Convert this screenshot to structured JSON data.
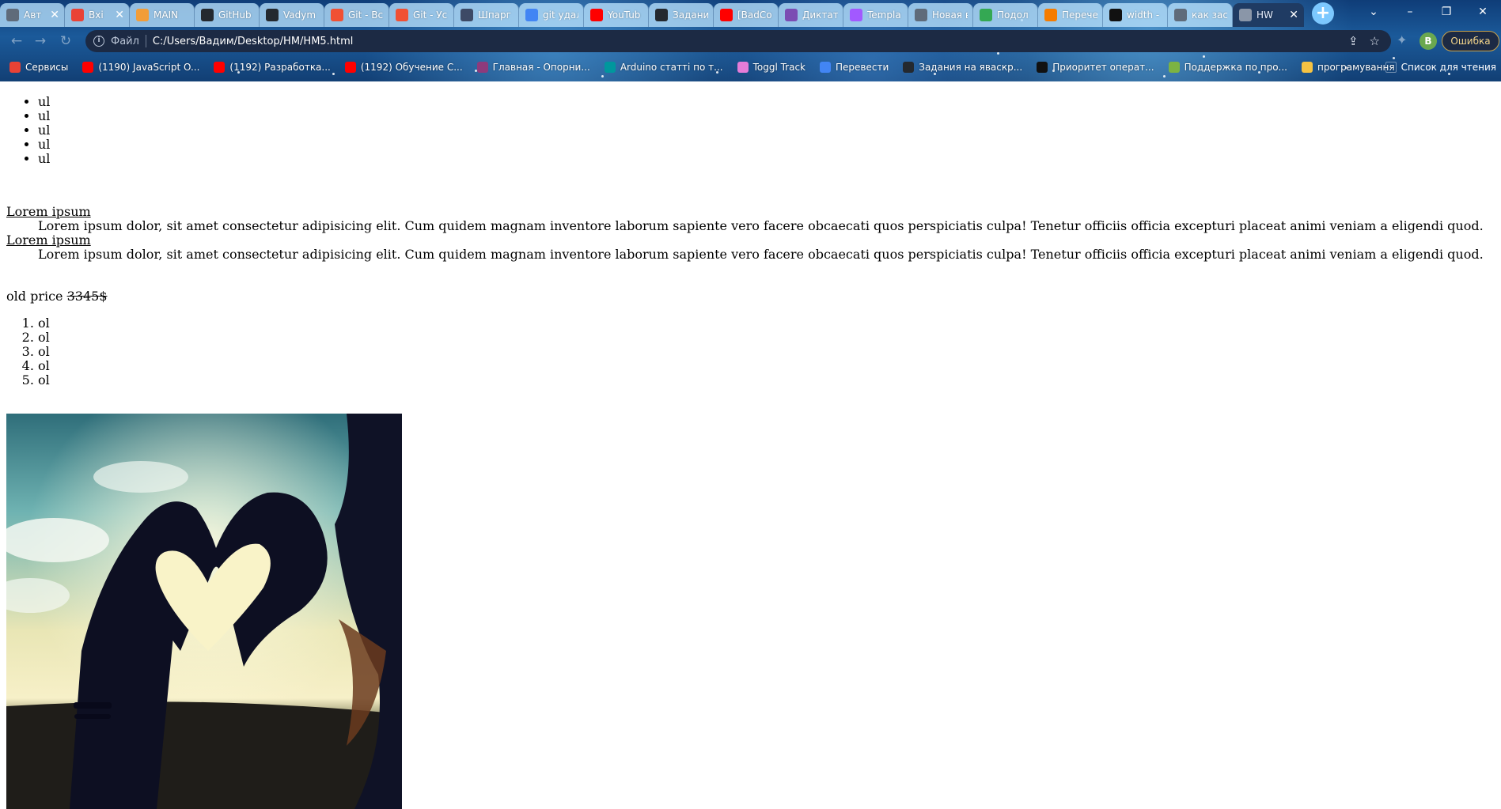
{
  "browser": {
    "tabs": [
      {
        "title": "Авт",
        "favicon": "globe-icon",
        "color": "#5f6b7a"
      },
      {
        "title": "Вхі",
        "favicon": "gmail-icon",
        "color": "#e94235"
      },
      {
        "title": "MAIN",
        "favicon": "k-icon",
        "color": "#f29d38"
      },
      {
        "title": "GitHub",
        "favicon": "github-icon",
        "color": "#24292f"
      },
      {
        "title": "Vadym",
        "favicon": "github-icon",
        "color": "#24292f"
      },
      {
        "title": "Git - Bc",
        "favicon": "git-icon",
        "color": "#f05033"
      },
      {
        "title": "Git - Уc",
        "favicon": "git-icon",
        "color": "#f05033"
      },
      {
        "title": "Шпарг",
        "favicon": "owl-icon",
        "color": "#3d4a66"
      },
      {
        "title": "git удал",
        "favicon": "google-icon",
        "color": "#4285f4"
      },
      {
        "title": "YouTub",
        "favicon": "youtube-music-icon",
        "color": "#ff0000"
      },
      {
        "title": "Задани",
        "favicon": "github-icon",
        "color": "#24292f"
      },
      {
        "title": "[BadCo",
        "favicon": "youtube-icon",
        "color": "#ff0000"
      },
      {
        "title": "Диктат",
        "favicon": "book-icon",
        "color": "#7b4db3"
      },
      {
        "title": "Templa",
        "favicon": "figma-icon",
        "color": "#a259ff"
      },
      {
        "title": "Новая в",
        "favicon": "chrome-icon",
        "color": "#5f6b7a"
      },
      {
        "title": "Подол",
        "favicon": "maps-icon",
        "color": "#34a853"
      },
      {
        "title": "Перече",
        "favicon": "sp-icon",
        "color": "#f57c00"
      },
      {
        "title": "width -",
        "favicon": "codepen-icon",
        "color": "#111111"
      },
      {
        "title": "как зас",
        "favicon": "globe-icon",
        "color": "#5f6b7a"
      },
      {
        "title": "HW",
        "favicon": "globe-icon",
        "color": "#8a96a8",
        "active": true
      }
    ],
    "new_tab_label": "+",
    "window_controls": {
      "tab_search": "⌄",
      "minimize": "–",
      "restore": "❐",
      "close": "✕"
    },
    "address": {
      "scheme_label": "Файл",
      "url": "C:/Users/Вадим/Desktop/HM/HM5.html"
    },
    "profile_initial": "B",
    "error_label": "Ошибка",
    "bookmarks": [
      {
        "label": "Сервисы",
        "icon": "apps-grid-icon",
        "color": "#e94235"
      },
      {
        "label": "(1190) JavaScript O...",
        "icon": "youtube-icon",
        "color": "#ff0000"
      },
      {
        "label": "(1192) Разработка...",
        "icon": "youtube-icon",
        "color": "#ff0000"
      },
      {
        "label": "(1192) Обучение С...",
        "icon": "youtube-icon",
        "color": "#ff0000"
      },
      {
        "label": "Главная - Опорни...",
        "icon": "bookmark-page-icon",
        "color": "#8e3a7c"
      },
      {
        "label": "Arduino статті по т...",
        "icon": "arduino-icon",
        "color": "#00979d"
      },
      {
        "label": "Toggl Track",
        "icon": "toggl-icon",
        "color": "#e57cd8"
      },
      {
        "label": "Перевести",
        "icon": "translate-icon",
        "color": "#4285f4"
      },
      {
        "label": "Задания на яваскр...",
        "icon": "github-icon",
        "color": "#24292f"
      },
      {
        "label": "Приоритет операт...",
        "icon": "codepen-icon",
        "color": "#111111"
      },
      {
        "label": "Поддержка по про...",
        "icon": "a-logo-icon",
        "color": "#7cb342"
      },
      {
        "label": "програмування",
        "icon": "folder-icon",
        "color": "#f6c343"
      }
    ],
    "reading_list_label": "Список для чтения"
  },
  "page": {
    "ul_items": [
      "ul",
      "ul",
      "ul",
      "ul",
      "ul"
    ],
    "definitions": [
      {
        "term": "Lorem ipsum",
        "description": "Lorem ipsum dolor, sit amet consectetur adipisicing elit. Cum quidem magnam inventore laborum sapiente vero facere obcaecati quos perspiciatis culpa! Tenetur officiis officia excepturi placeat animi veniam a eligendi quod."
      },
      {
        "term": "Lorem ipsum",
        "description": "Lorem ipsum dolor, sit amet consectetur adipisicing elit. Cum quidem magnam inventore laborum sapiente vero facere obcaecati quos perspiciatis culpa! Tenetur officiis officia excepturi placeat animi veniam a eligendi quod."
      }
    ],
    "price_label": "old price",
    "old_price": "3345$",
    "ol_items": [
      "ol",
      "ol",
      "ol",
      "ol",
      "ol"
    ],
    "photo_subject": "heart-hands-silhouette-photo"
  }
}
